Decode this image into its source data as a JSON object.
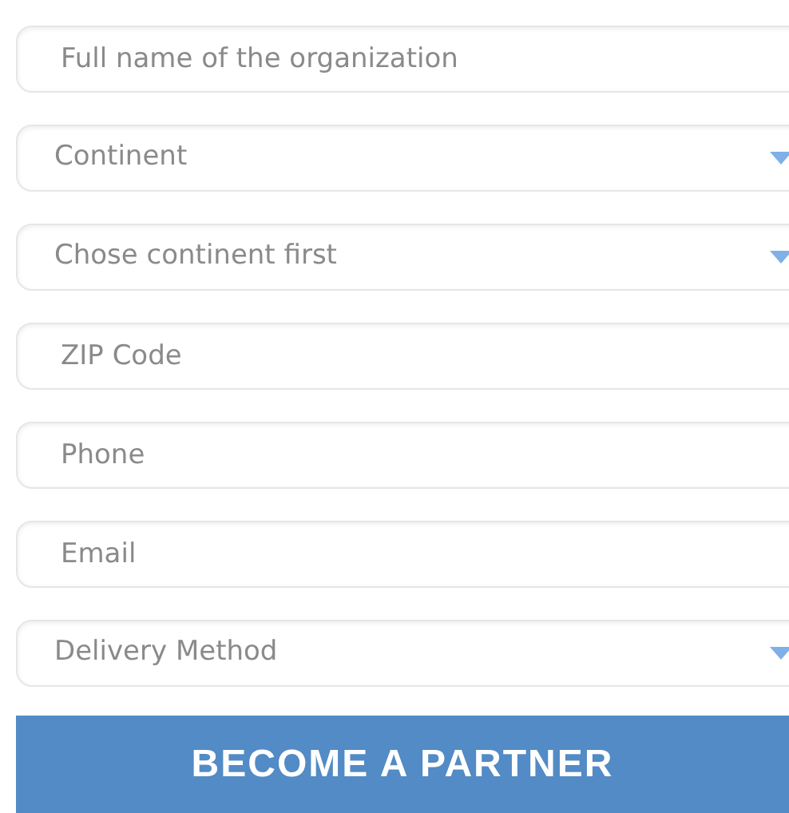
{
  "fields": [
    {
      "kind": "text",
      "placeholder": "Full name of the organization"
    },
    {
      "kind": "select",
      "placeholder": "Continent"
    },
    {
      "kind": "select",
      "placeholder": "Chose continent first"
    },
    {
      "kind": "text",
      "placeholder": "ZIP Code"
    },
    {
      "kind": "text",
      "placeholder": "Phone"
    },
    {
      "kind": "text",
      "placeholder": "Email"
    },
    {
      "kind": "select",
      "placeholder": "Delivery Method"
    }
  ],
  "submit_button": {
    "label": "BECOME A PARTNER"
  }
}
